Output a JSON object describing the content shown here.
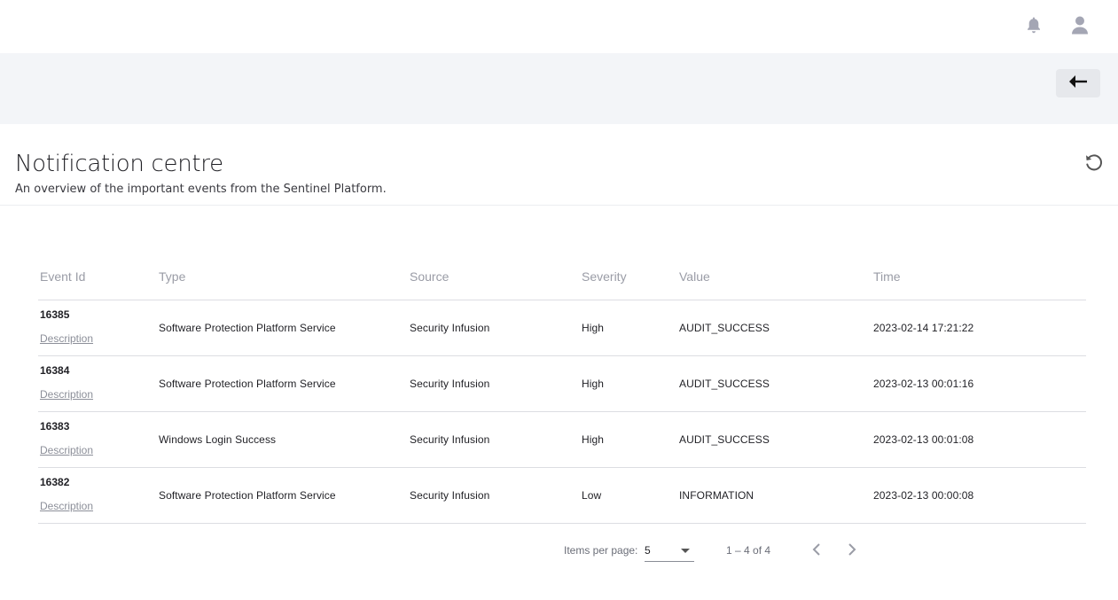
{
  "topbar": {
    "bell_icon": "bell-icon",
    "user_icon": "user-icon"
  },
  "subbar": {
    "back_icon": "arrow-left-icon"
  },
  "header": {
    "title": "Notification centre",
    "subtitle": "An overview of the important events from the Sentinel Platform.",
    "refresh_icon": "refresh-icon"
  },
  "table": {
    "columns": [
      "Event Id",
      "Type",
      "Source",
      "Severity",
      "Value",
      "Time"
    ],
    "rows": [
      {
        "event_id": "16385",
        "description_link": "Description",
        "type": "Software Protection Platform Service",
        "source": "Security Infusion",
        "severity": "High",
        "value": "AUDIT_SUCCESS",
        "time": "2023-02-14 17:21:22"
      },
      {
        "event_id": "16384",
        "description_link": "Description",
        "type": "Software Protection Platform Service",
        "source": "Security Infusion",
        "severity": "High",
        "value": "AUDIT_SUCCESS",
        "time": "2023-02-13 00:01:16"
      },
      {
        "event_id": "16383",
        "description_link": "Description",
        "type": "Windows Login Success",
        "source": "Security Infusion",
        "severity": "High",
        "value": "AUDIT_SUCCESS",
        "time": "2023-02-13 00:01:08"
      },
      {
        "event_id": "16382",
        "description_link": "Description",
        "type": "Software Protection Platform Service",
        "source": "Security Infusion",
        "severity": "Low",
        "value": "INFORMATION",
        "time": "2023-02-13 00:00:08"
      }
    ]
  },
  "paginator": {
    "items_per_page_label": "Items per page:",
    "items_per_page_value": "5",
    "range_label": "1 – 4 of 4"
  }
}
